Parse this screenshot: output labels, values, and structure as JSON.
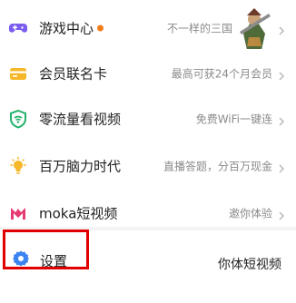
{
  "menu": {
    "items": [
      {
        "title": "游戏中心",
        "subtitle": "不一样的三国",
        "icon": "game-controller-icon",
        "badge": true
      },
      {
        "title": "会员联名卡",
        "subtitle": "最高可获24个月会员",
        "icon": "card-icon"
      },
      {
        "title": "零流量看视频",
        "subtitle": "免费WiFi一键连",
        "icon": "wifi-shield-icon"
      },
      {
        "title": "百万脑力时代",
        "subtitle": "直播答题，分百万现金",
        "icon": "lightbulb-icon"
      },
      {
        "title": "moka短视频",
        "subtitle": "邀你体验",
        "icon": "moka-logo-icon"
      }
    ]
  },
  "settings": {
    "title": "设置",
    "icon": "gear-icon"
  },
  "watermark": {
    "text": "你体短视频"
  },
  "colors": {
    "badge": "#f07b1a",
    "highlight": "#e00000",
    "icon_blue": "#3b83f0",
    "icon_purple": "#7a5cf0",
    "icon_yellow": "#f6b829",
    "icon_green": "#21b36b",
    "icon_moka": "#e63a72"
  }
}
